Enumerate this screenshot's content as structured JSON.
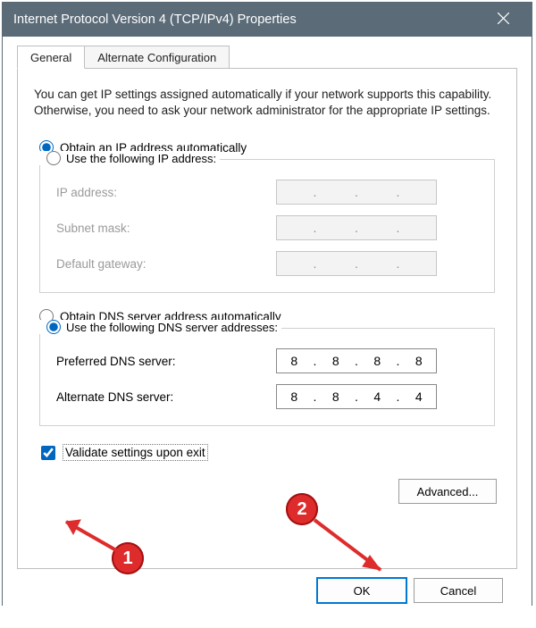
{
  "window": {
    "title": "Internet Protocol Version 4 (TCP/IPv4) Properties"
  },
  "tabs": {
    "general": "General",
    "alternate": "Alternate Configuration"
  },
  "intro": "You can get IP settings assigned automatically if your network supports this capability. Otherwise, you need to ask your network administrator for the appropriate IP settings.",
  "ip": {
    "auto": "Obtain an IP address automatically",
    "manual": "Use the following IP address:",
    "addrLabel": "IP address:",
    "maskLabel": "Subnet mask:",
    "gwLabel": "Default gateway:",
    "addr": [
      "",
      "",
      "",
      ""
    ],
    "mask": [
      "",
      "",
      "",
      ""
    ],
    "gw": [
      "",
      "",
      "",
      ""
    ]
  },
  "dns": {
    "auto": "Obtain DNS server address automatically",
    "manual": "Use the following DNS server addresses:",
    "prefLabel": "Preferred DNS server:",
    "altLabel": "Alternate DNS server:",
    "pref": [
      "8",
      "8",
      "8",
      "8"
    ],
    "alt": [
      "8",
      "8",
      "4",
      "4"
    ]
  },
  "validate": "Validate settings upon exit",
  "advanced": "Advanced...",
  "buttons": {
    "ok": "OK",
    "cancel": "Cancel"
  },
  "annot": {
    "one": "1",
    "two": "2"
  }
}
